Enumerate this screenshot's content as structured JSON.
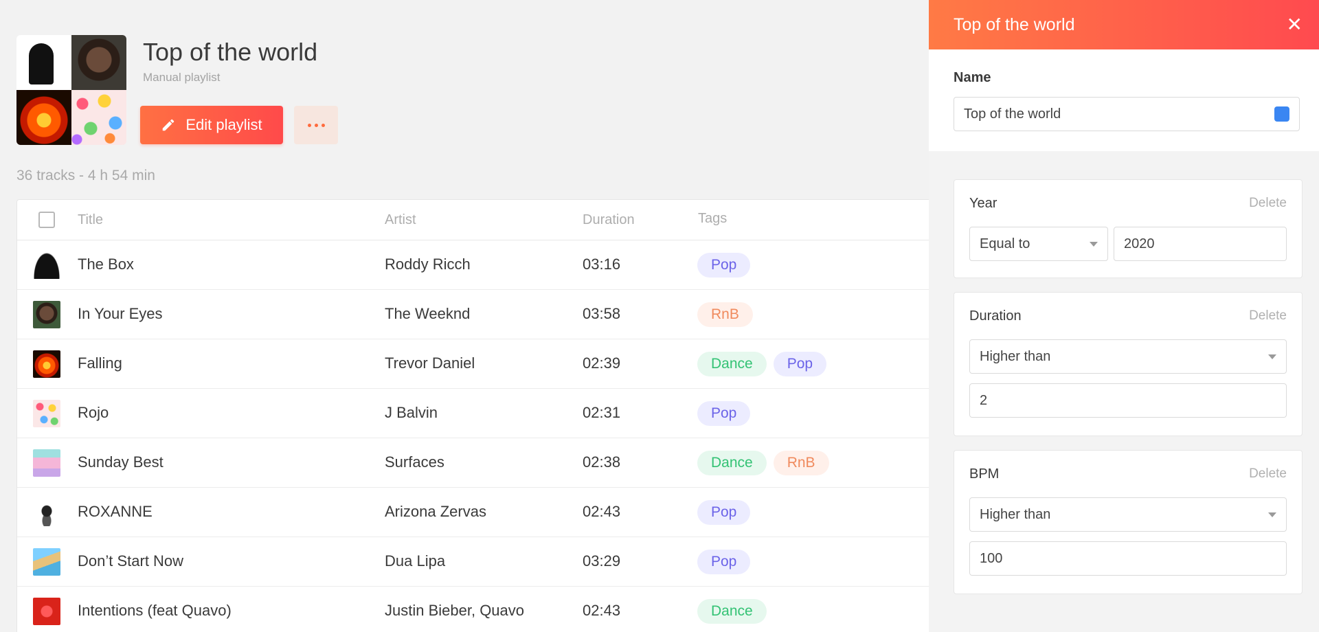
{
  "playlist": {
    "title": "Top of the world",
    "subtitle": "Manual playlist",
    "edit_label": "Edit playlist",
    "summary": "36 tracks - 4 h 54 min"
  },
  "table": {
    "headers": {
      "title": "Title",
      "artist": "Artist",
      "duration": "Duration",
      "tags": "Tags"
    },
    "rows": [
      {
        "title": "The Box",
        "artist": "Roddy Ricch",
        "duration": "03:16",
        "tags": [
          "Pop"
        ]
      },
      {
        "title": "In Your Eyes",
        "artist": "The Weeknd",
        "duration": "03:58",
        "tags": [
          "RnB"
        ]
      },
      {
        "title": "Falling",
        "artist": "Trevor Daniel",
        "duration": "02:39",
        "tags": [
          "Dance",
          "Pop"
        ]
      },
      {
        "title": "Rojo",
        "artist": "J Balvin",
        "duration": "02:31",
        "tags": [
          "Pop"
        ]
      },
      {
        "title": "Sunday Best",
        "artist": "Surfaces",
        "duration": "02:38",
        "tags": [
          "Dance",
          "RnB"
        ]
      },
      {
        "title": "ROXANNE",
        "artist": "Arizona Zervas",
        "duration": "02:43",
        "tags": [
          "Pop"
        ]
      },
      {
        "title": "Don’t Start Now",
        "artist": "Dua Lipa",
        "duration": "03:29",
        "tags": [
          "Pop"
        ]
      },
      {
        "title": "Intentions (feat Quavo)",
        "artist": "Justin Bieber, Quavo",
        "duration": "02:43",
        "tags": [
          "Dance"
        ]
      }
    ]
  },
  "panel": {
    "title": "Top of the world",
    "close_icon": "close-icon",
    "name_label": "Name",
    "name_value": "Top of the world",
    "color": "#3a86f2",
    "filters": {
      "year": {
        "label": "Year",
        "delete": "Delete",
        "operator": "Equal to",
        "value": "2020"
      },
      "duration": {
        "label": "Duration",
        "delete": "Delete",
        "operator": "Higher than",
        "value": "2"
      },
      "bpm": {
        "label": "BPM",
        "delete": "Delete",
        "operator": "Higher than",
        "value": "100"
      }
    }
  },
  "colors": {
    "accent_start": "#ff7043",
    "accent_end": "#ff4a4a",
    "pop": "#6b63e8",
    "rnb": "#f08a5d",
    "dance": "#33c274"
  }
}
